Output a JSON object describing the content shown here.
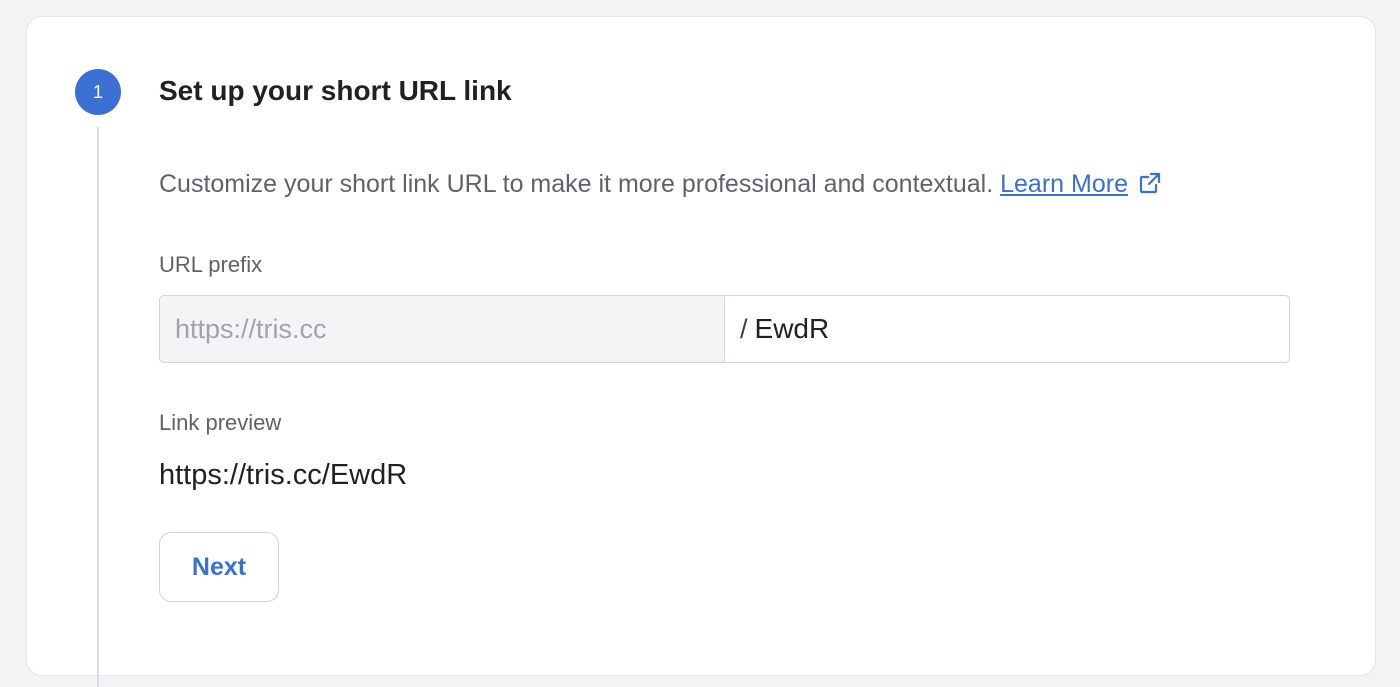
{
  "step": {
    "number": "1",
    "title": "Set up your short URL link",
    "accent_color": "#3b6fd1"
  },
  "description": {
    "text": "Customize your short link URL to make it more professional and contextual.",
    "link_label": "Learn More",
    "link_icon": "external-link-icon"
  },
  "url_prefix": {
    "label": "URL prefix",
    "prefix_value": "https://tris.cc",
    "separator": "/",
    "suffix_value": "EwdR"
  },
  "link_preview": {
    "label": "Link preview",
    "value": "https://tris.cc/EwdR"
  },
  "actions": {
    "next_label": "Next"
  }
}
